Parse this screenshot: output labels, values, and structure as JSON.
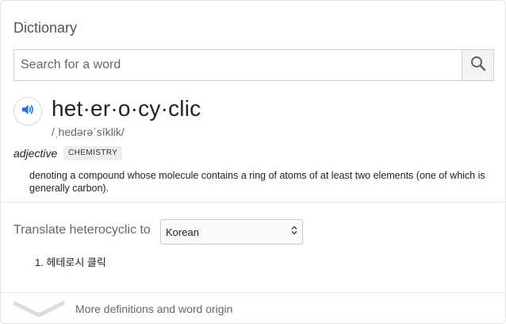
{
  "panel": {
    "title": "Dictionary"
  },
  "search": {
    "placeholder": "Search for a word",
    "value": "",
    "icon": "search-icon"
  },
  "entry": {
    "speaker_icon": "speaker-icon",
    "headword": "het·er·o·cy·clic",
    "phonetic": "/ˌhedərəˈsīklik/",
    "part_of_speech": "adjective",
    "tag": "CHEMISTRY",
    "definition": "denoting a compound whose molecule contains a ring of atoms of at least two elements (one of which is generally carbon)."
  },
  "translate": {
    "label": "Translate heterocyclic to",
    "selected_language": "Korean",
    "results": [
      "1. 헤테로시 클릭"
    ]
  },
  "footer": {
    "more_label": "More definitions and word origin",
    "chevron_icon": "chevron-down-icon"
  },
  "colors": {
    "accent": "#1a73e8",
    "muted_text": "#666666",
    "border": "#d0d0d0"
  }
}
